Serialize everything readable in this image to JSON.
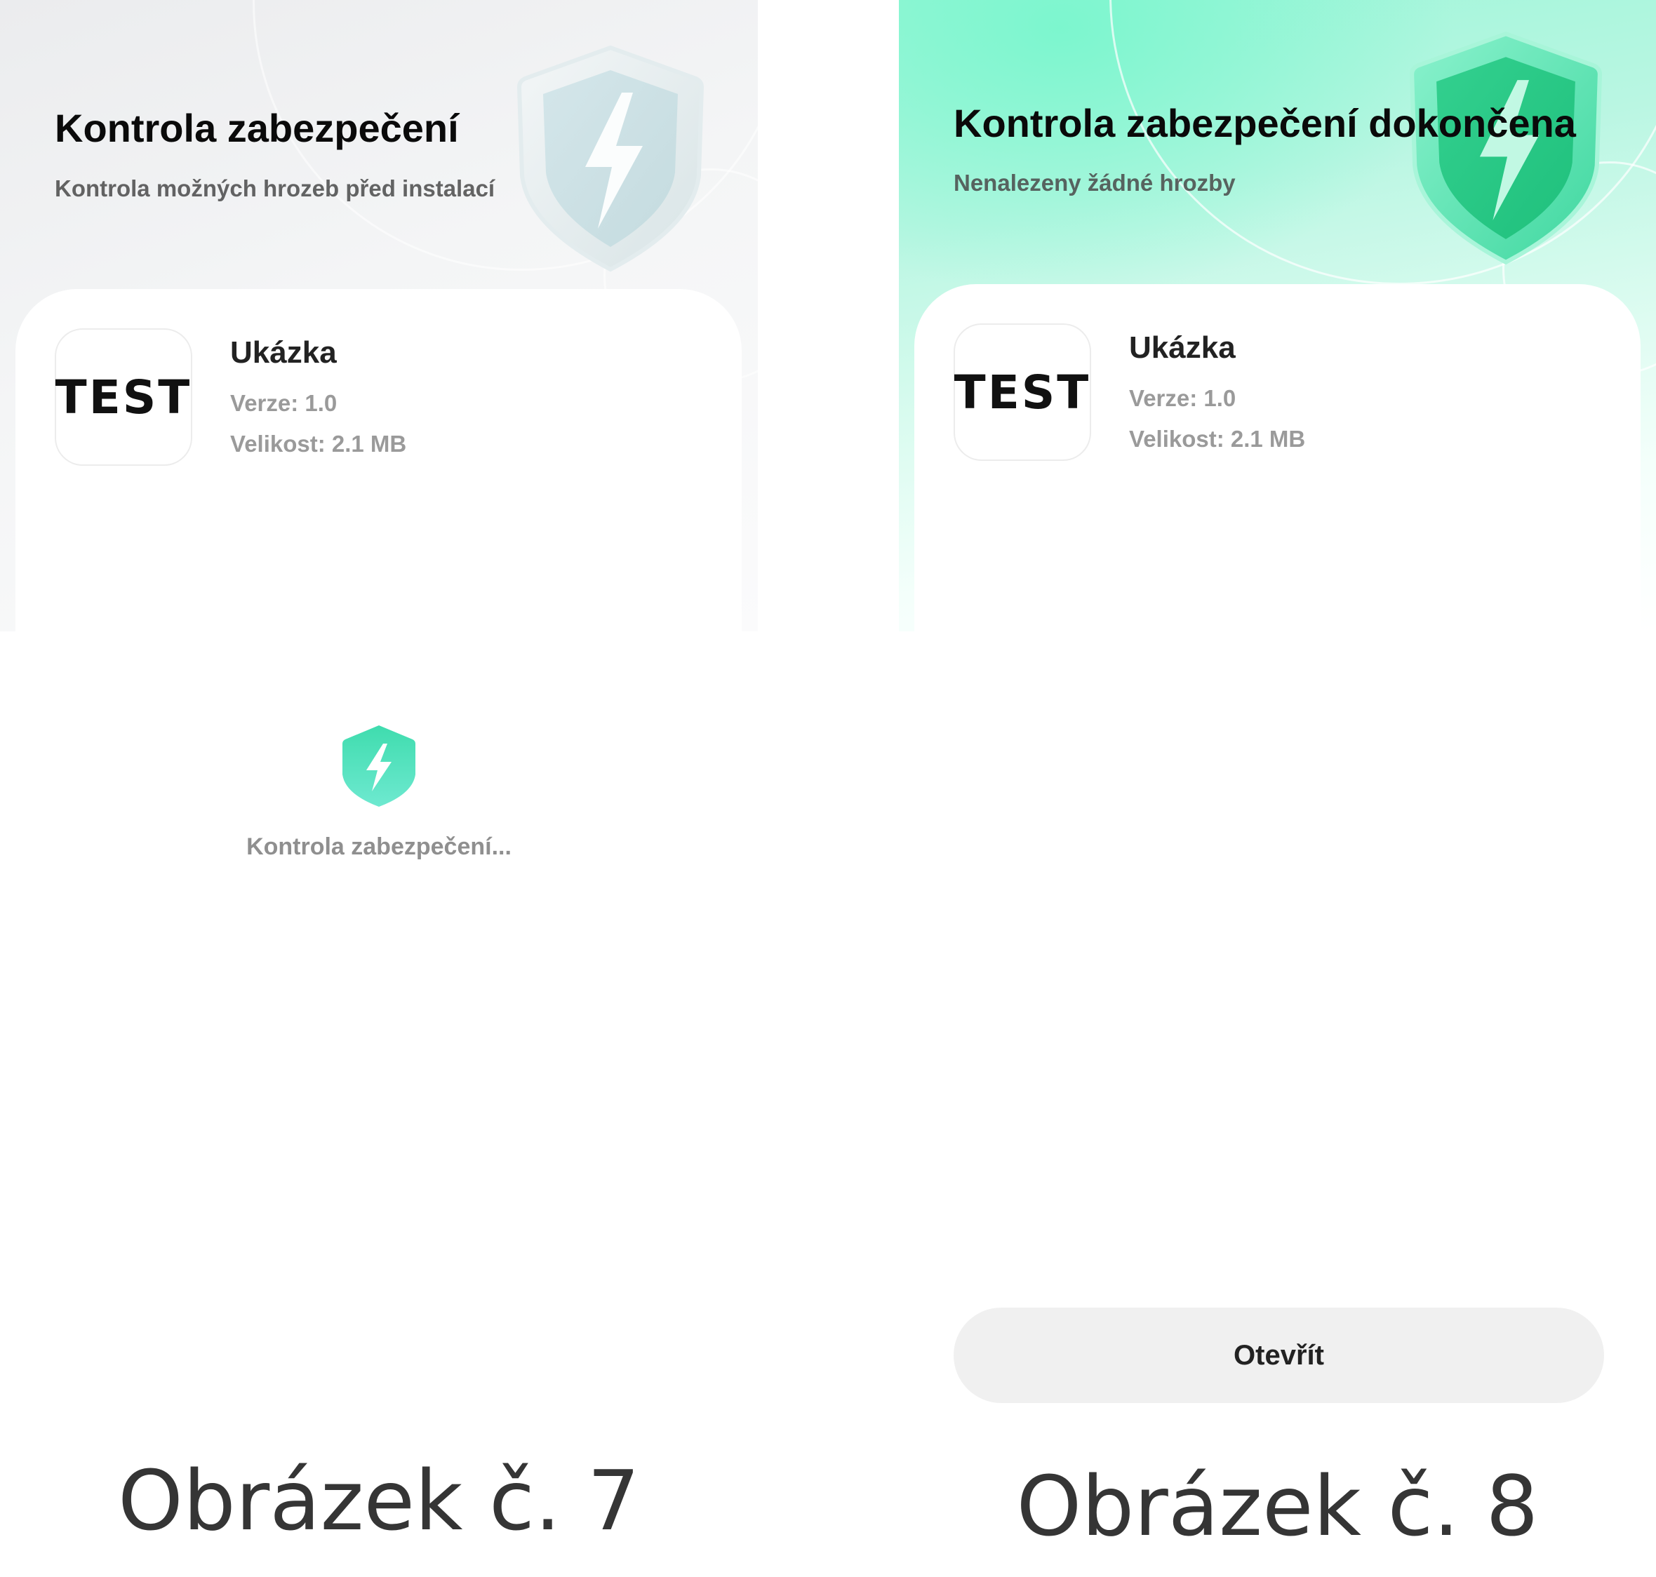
{
  "screen7": {
    "title": "Kontrola zabezpečení",
    "subtitle": "Kontrola možných hrozeb před instalací",
    "app": {
      "icon_text": "TEST",
      "name": "Ukázka",
      "version": "Verze: 1.0",
      "size": "Velikost: 2.1 MB"
    },
    "status_text": "Kontrola zabezpečení...",
    "caption": "Obrázek č. 7"
  },
  "screen8": {
    "title": "Kontrola zabezpečení dokončena",
    "subtitle": "Nenalezeny žádné hrozby",
    "app": {
      "icon_text": "TEST",
      "name": "Ukázka",
      "version": "Verze: 1.0",
      "size": "Velikost: 2.1 MB"
    },
    "open_button_label": "Otevřít",
    "caption": "Obrázek č. 8"
  },
  "icons": {
    "hero_shield_7": "shield-lightning-icon",
    "hero_shield_8": "shield-lightning-icon",
    "scan_shield": "shield-lightning-icon"
  },
  "colors": {
    "accent_green": "#4fe0b6",
    "hero_green": "#9df5d8",
    "hero_gray": "#ebecee",
    "button_bg": "#f0f0f0"
  }
}
